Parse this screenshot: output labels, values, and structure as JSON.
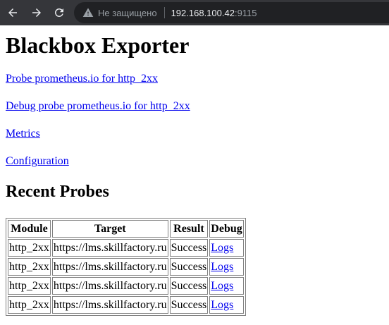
{
  "browser": {
    "security_label": "Не защищено",
    "url_host": "192.168.100.42",
    "url_port": ":9115",
    "icons": {
      "back": "arrow-left-icon",
      "forward": "arrow-right-icon",
      "reload": "reload-icon",
      "security": "warning-triangle-icon"
    }
  },
  "page": {
    "title": "Blackbox Exporter",
    "links": [
      "Probe prometheus.io for http_2xx",
      "Debug probe prometheus.io for http_2xx",
      "Metrics",
      "Configuration"
    ],
    "recent_title": "Recent Probes",
    "table": {
      "headers": [
        "Module",
        "Target",
        "Result",
        "Debug"
      ],
      "rows": [
        [
          "http_2xx",
          "https://lms.skillfactory.ru",
          "Success",
          "Logs"
        ],
        [
          "http_2xx",
          "https://lms.skillfactory.ru",
          "Success",
          "Logs"
        ],
        [
          "http_2xx",
          "https://lms.skillfactory.ru",
          "Success",
          "Logs"
        ],
        [
          "http_2xx",
          "https://lms.skillfactory.ru",
          "Success",
          "Logs"
        ]
      ]
    }
  },
  "colors": {
    "toolbar": "#35363a",
    "omnibox": "#202124",
    "link": "#0000ee"
  }
}
